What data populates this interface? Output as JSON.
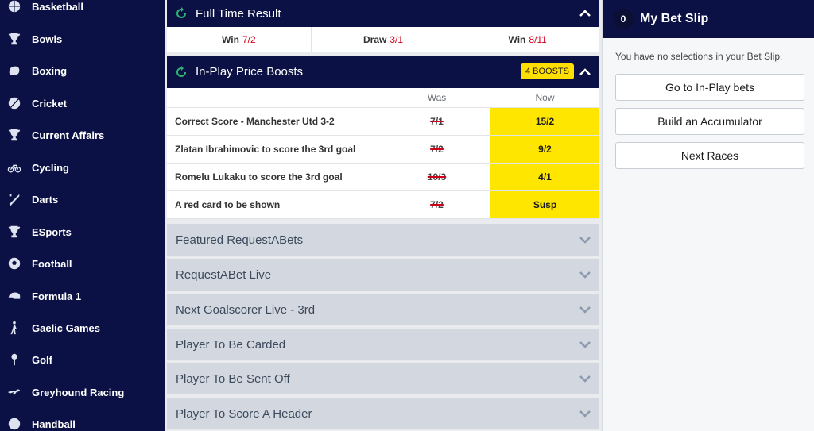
{
  "sidebar": {
    "items": [
      {
        "label": "Basketball",
        "icon": "basketball-icon"
      },
      {
        "label": "Bowls",
        "icon": "trophy-icon"
      },
      {
        "label": "Boxing",
        "icon": "boxing-glove-icon"
      },
      {
        "label": "Cricket",
        "icon": "cricket-ball-icon"
      },
      {
        "label": "Current Affairs",
        "icon": "trophy-icon"
      },
      {
        "label": "Cycling",
        "icon": "bicycle-icon"
      },
      {
        "label": "Darts",
        "icon": "darts-icon"
      },
      {
        "label": "ESports",
        "icon": "trophy-icon"
      },
      {
        "label": "Football",
        "icon": "football-icon"
      },
      {
        "label": "Formula 1",
        "icon": "racing-helmet-icon"
      },
      {
        "label": "Gaelic Games",
        "icon": "athlete-icon"
      },
      {
        "label": "Golf",
        "icon": "golf-icon"
      },
      {
        "label": "Greyhound Racing",
        "icon": "greyhound-icon"
      },
      {
        "label": "Handball",
        "icon": "handball-icon"
      }
    ]
  },
  "full_time": {
    "title": "Full Time Result",
    "outcomes": [
      {
        "label": "Win",
        "odds": "7/2"
      },
      {
        "label": "Draw",
        "odds": "3/1"
      },
      {
        "label": "Win",
        "odds": "8/11"
      }
    ]
  },
  "boosts": {
    "title": "In-Play Price Boosts",
    "badge": "4 BOOSTS",
    "col_was": "Was",
    "col_now": "Now",
    "rows": [
      {
        "label": "Correct Score - Manchester Utd 3-2",
        "was": "7/1",
        "now": "15/2"
      },
      {
        "label": "Zlatan Ibrahimovic to score the 3rd goal",
        "was": "7/2",
        "now": "9/2"
      },
      {
        "label": "Romelu Lukaku to score the 3rd goal",
        "was": "10/3",
        "now": "4/1"
      },
      {
        "label": "A red card to be shown",
        "was": "7/2",
        "now": "Susp"
      }
    ]
  },
  "markets": [
    "Featured RequestABets",
    "RequestABet Live",
    "Next Goalscorer Live - 3rd",
    "Player To Be Carded",
    "Player To Be Sent Off",
    "Player To Score A Header"
  ],
  "betslip": {
    "count": "0",
    "title": "My Bet Slip",
    "message": "You have no selections in your Bet Slip.",
    "buttons": [
      "Go to In-Play bets",
      "Build an Accumulator",
      "Next Races"
    ]
  },
  "colors": {
    "navy": "#0b1144",
    "boost_yellow": "#ffe600",
    "odds_red": "#d0021b",
    "refresh_green": "#2bb673"
  }
}
